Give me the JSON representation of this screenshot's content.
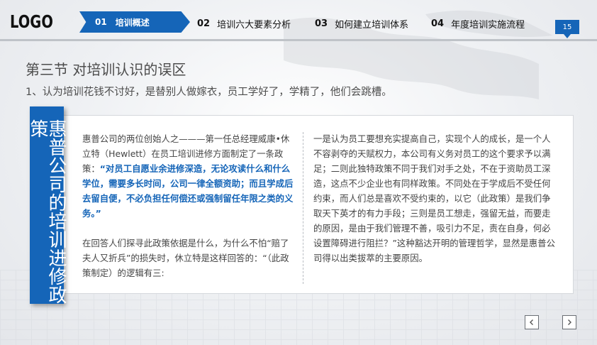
{
  "header": {
    "logo": "LOGO",
    "nav": [
      {
        "num": "01",
        "label": "培训概述"
      },
      {
        "num": "02",
        "label": "培训六大要素分析"
      },
      {
        "num": "03",
        "label": "如何建立培训体系"
      },
      {
        "num": "04",
        "label": "年度培训实施流程"
      }
    ],
    "page_number": "15"
  },
  "title": "第三节  对培训认识的误区",
  "subtitle": "1、认为培训花钱不讨好，是替别人做嫁衣，员工学好了，学精了，他们会跳槽。",
  "side_tab": "惠普公司的培训进修政策",
  "left_column": {
    "p1_intro": "惠普公司的两位创始人之———第一任总经理威康•休立特（Hewlett）在员工培训进修方面制定了一条政策：",
    "p1_highlight": "“对员工自愿业余进修深造，无论攻读什么和什么学位，需要多长时间，公司一律全额资助；而且学成后去留自便，不必负担任何偿还或强制留任年限之类的义务。”",
    "p2": "在回答人们探寻此政策依据是什么，为什么不怕“赔了夫人又折兵”的损失时，休立特是这样回答的：“（此政策制定）的逻辑有三:"
  },
  "right_column": {
    "text": "一是认为员工要想充实提高自己，实现个人的成长，是一个人不容剥夺的天赋权力，本公司有义务对员工的这个要求予以满足；二则此独特政策不同于我们对手之处，不在于资助员工深造，这点不少企业也有同样政策。不同处在于学成后不受任何约束，而人们总是喜欢不受约束的，以它（此政策）是我们争取天下英才的有力手段；三则是员工想走，强留无益，而要走的原因，是由于我们管理不善，吸引力不足，责在自身，何必设置障碍进行阻拦？”这种豁达开明的管理哲学，显然是惠普公司得以出类拔萃的主要原因。"
  },
  "controls": {
    "prev_icon": "chevron-left-icon",
    "next_icon": "chevron-right-icon"
  },
  "colors": {
    "accent": "#1565b8",
    "text": "#444444"
  }
}
